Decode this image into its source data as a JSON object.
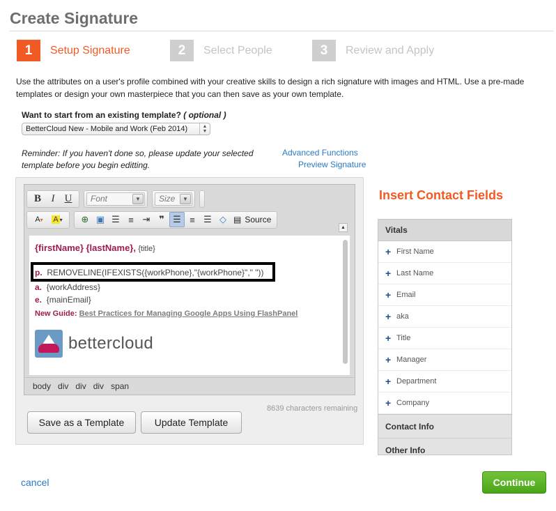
{
  "page": {
    "title": "Create Signature"
  },
  "steps": [
    {
      "num": "1",
      "label": "Setup Signature"
    },
    {
      "num": "2",
      "label": "Select People"
    },
    {
      "num": "3",
      "label": "Review and Apply"
    }
  ],
  "intro": "Use the attributes on a user's profile combined with your creative skills to design a rich signature with images and HTML. Use a pre-made templates or design your own masterpiece that you can then save as your own template.",
  "template": {
    "question": "Want to start from an existing template?",
    "optional": "( optional )",
    "selected": "BetterCloud New - Mobile and Work (Feb 2014)"
  },
  "reminder": "Reminder: If you haven't done so, please update your selected template before you begin editting.",
  "links": {
    "advanced": "Advanced Functions",
    "preview": "Preview Signature"
  },
  "toolbar": {
    "bold": "B",
    "italic": "I",
    "underline": "U",
    "font_placeholder": "Font",
    "size_placeholder": "Size",
    "source": "Source"
  },
  "editor": {
    "first_name": "{firstName}",
    "last_name": "{lastName}",
    "comma": ",",
    "title_var": "{title}",
    "phone_label": "p.",
    "phone_expr": "REMOVELINE(IFEXISTS({workPhone},\"{workPhone}\",\" \"))",
    "address_label": "a.",
    "address_var": "{workAddress}",
    "email_label": "e.",
    "email_var": "{mainEmail}",
    "guide_label": "New Guide:",
    "guide_link": "Best Practices for Managing Google Apps Using FlashPanel",
    "logo_text": "bettercloud",
    "path": [
      "body",
      "div",
      "div",
      "div",
      "span"
    ],
    "remaining": "8639 characters remaining"
  },
  "buttons": {
    "save_template": "Save as a Template",
    "update_template": "Update Template",
    "cancel": "cancel",
    "continue": "Continue"
  },
  "insert": {
    "title": "Insert Contact Fields",
    "vitals_header": "Vitals",
    "fields": [
      "First Name",
      "Last Name",
      "Email",
      "aka",
      "Title",
      "Manager",
      "Department",
      "Company"
    ],
    "sections": [
      "Contact Info",
      "Other Info"
    ]
  },
  "colors": {
    "accent": "#f15a24",
    "link": "#2a7ac4",
    "continue": "#5db42a",
    "signature_label": "#9c1c4f"
  }
}
